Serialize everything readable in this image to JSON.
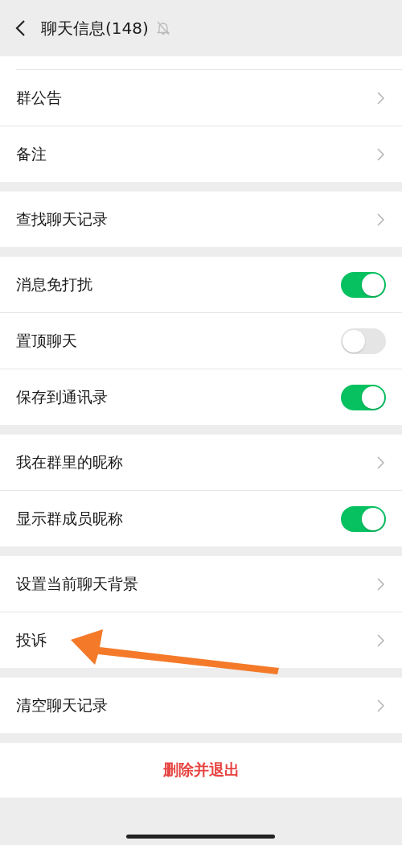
{
  "header": {
    "title": "聊天信息(148)",
    "muted": true
  },
  "sections": [
    {
      "items": [
        {
          "kind": "link",
          "label": "群公告"
        },
        {
          "kind": "link",
          "label": "备注"
        }
      ],
      "cut_top": true
    },
    {
      "items": [
        {
          "kind": "link",
          "label": "查找聊天记录"
        }
      ]
    },
    {
      "items": [
        {
          "kind": "toggle",
          "label": "消息免打扰",
          "on": true
        },
        {
          "kind": "toggle",
          "label": "置顶聊天",
          "on": false
        },
        {
          "kind": "toggle",
          "label": "保存到通讯录",
          "on": true
        }
      ]
    },
    {
      "items": [
        {
          "kind": "link",
          "label": "我在群里的昵称"
        },
        {
          "kind": "toggle",
          "label": "显示群成员昵称",
          "on": true
        }
      ]
    },
    {
      "items": [
        {
          "kind": "link",
          "label": "设置当前聊天背景"
        },
        {
          "kind": "link",
          "label": "投诉"
        }
      ]
    },
    {
      "items": [
        {
          "kind": "link",
          "label": "清空聊天记录"
        }
      ]
    }
  ],
  "danger_button": {
    "label": "删除并退出"
  },
  "annotation": {
    "kind": "arrow"
  }
}
